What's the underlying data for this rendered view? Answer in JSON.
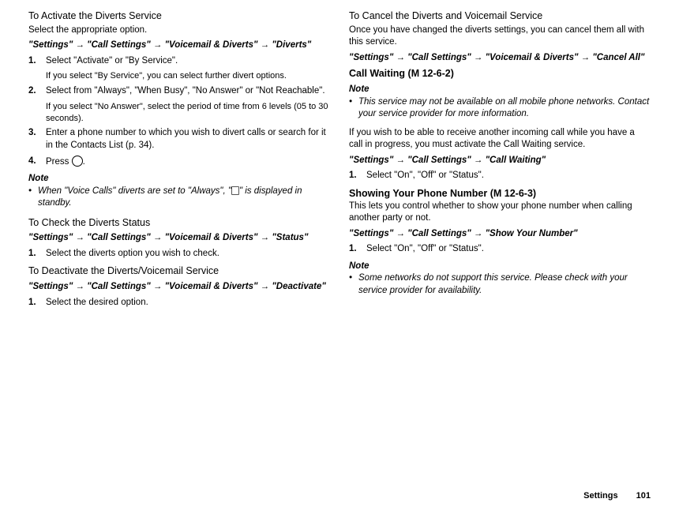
{
  "left": {
    "activate": {
      "title": "To Activate the Diverts Service",
      "intro": "Select the appropriate option.",
      "path": "\"Settings\" → \"Call Settings\" → \"Voicemail & Diverts\" → \"Diverts\"",
      "step1": "Select \"Activate\" or \"By Service\".",
      "step1sub": "If you select \"By Service\", you can select further divert options.",
      "step2": "Select from \"Always\", \"When Busy\", \"No Answer\" or \"Not Reachable\".",
      "step2sub": "If you select \"No Answer\", select the period of time from 6 levels (05 to 30 seconds).",
      "step3": "Enter a phone number to which you wish to divert calls or search for it in the Contacts List (p. 34).",
      "step4pre": "Press ",
      "step4post": ".",
      "notelabel": "Note",
      "notepre": "When \"Voice Calls\" diverts are set to \"Always\", \"",
      "notepost": "\" is displayed in standby."
    },
    "check": {
      "title": "To Check the Diverts Status",
      "path": "\"Settings\" → \"Call Settings\" → \"Voicemail & Diverts\" → \"Status\"",
      "step1": "Select the diverts option you wish to check."
    },
    "deactivate": {
      "title": "To Deactivate the Diverts/Voicemail Service",
      "path": "\"Settings\" → \"Call Settings\" → \"Voicemail & Diverts\" → \"Deactivate\"",
      "step1": "Select the desired option."
    }
  },
  "right": {
    "cancel": {
      "title": "To Cancel the Diverts and Voicemail Service",
      "intro": "Once you have changed the diverts settings, you can cancel them all with this service.",
      "path": "\"Settings\" → \"Call Settings\" → \"Voicemail & Diverts\" → \"Cancel All\""
    },
    "callwaiting": {
      "title": "Call Waiting",
      "mcode": " (M 12-6-2)",
      "notelabel": "Note",
      "note": "This service may not be available on all mobile phone networks. Contact your service provider for more information.",
      "para": "If you wish to be able to receive another incoming call while you have a call in progress, you must activate the Call Waiting service.",
      "path": "\"Settings\" → \"Call Settings\" → \"Call Waiting\"",
      "step1": "Select \"On\", \"Off\" or \"Status\"."
    },
    "shownum": {
      "title": "Showing Your Phone Number",
      "mcode": " (M 12-6-3)",
      "intro": "This lets you control whether to show your phone number when calling another party or not.",
      "path": "\"Settings\" → \"Call Settings\" → \"Show Your Number\"",
      "step1": "Select \"On\", \"Off\" or \"Status\".",
      "notelabel": "Note",
      "note": "Some networks do not support this service. Please check with your service provider for availability."
    }
  },
  "footer": {
    "section": "Settings",
    "page": "101"
  }
}
